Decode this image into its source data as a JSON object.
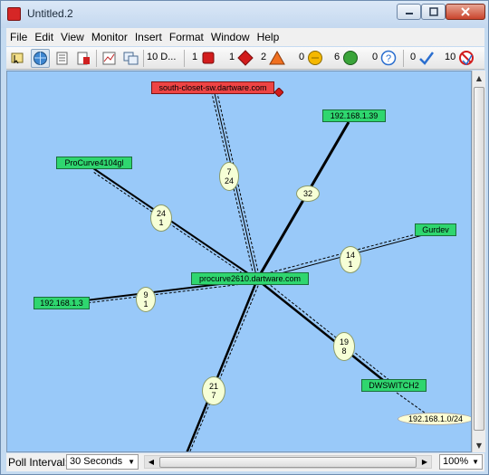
{
  "window": {
    "title": "Untitled.2"
  },
  "menu": [
    "File",
    "Edit",
    "View",
    "Monitor",
    "Insert",
    "Format",
    "Window",
    "Help"
  ],
  "toolbar": {
    "devices_count": "10 D...",
    "counters": [
      {
        "value": "1",
        "icon": "red-square-icon",
        "color": "#d21c1c"
      },
      {
        "value": "1",
        "icon": "red-diamond-icon",
        "color": "#d21c1c"
      },
      {
        "value": "2",
        "icon": "orange-triangle-icon",
        "color": "#f07020"
      },
      {
        "value": "0",
        "icon": "yellow-circle-icon",
        "color": "#f5b800"
      },
      {
        "value": "6",
        "icon": "green-circle-icon",
        "color": "#3aa43a"
      },
      {
        "value": "0",
        "icon": "question-circle-icon",
        "color": "#2a6ecf"
      },
      {
        "value": "0",
        "icon": "checkmark-icon",
        "color": "#2a6ecf"
      },
      {
        "value": "10",
        "icon": "no-symbol-icon",
        "color": "#d21c1c"
      }
    ]
  },
  "map": {
    "devices": [
      {
        "id": "south-closet",
        "label": "south-closet-sw.dartware.com",
        "status": "down"
      },
      {
        "id": "ip139",
        "label": "192.168.1.39",
        "status": "up"
      },
      {
        "id": "procurve4104",
        "label": "ProCurve4104gl",
        "status": "up"
      },
      {
        "id": "gurdev",
        "label": "Gurdev",
        "status": "up"
      },
      {
        "id": "procurve2610",
        "label": "procurve2610.dartware.com",
        "status": "up"
      },
      {
        "id": "ip13",
        "label": "192.168.1.3",
        "status": "up"
      },
      {
        "id": "dwswitch2",
        "label": "DWSWITCH2",
        "status": "up"
      },
      {
        "id": "net",
        "label": "192.168.1.0/24",
        "status": "network"
      }
    ],
    "links": [
      {
        "label": "7\n24"
      },
      {
        "label": "32"
      },
      {
        "label": "24\n1"
      },
      {
        "label": "14\n1"
      },
      {
        "label": "9\n1"
      },
      {
        "label": "19\n8"
      },
      {
        "label": "21\n7"
      }
    ]
  },
  "status": {
    "poll_label": "Poll Interval:",
    "poll_value": "30 Seconds",
    "zoom": "100%"
  }
}
